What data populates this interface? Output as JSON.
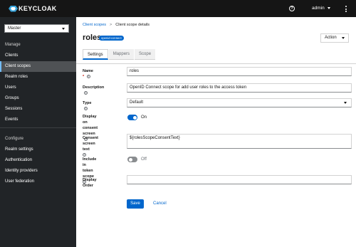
{
  "header": {
    "logo_text": "KEYCLOAK",
    "help_glyph": "?",
    "user": "admin"
  },
  "sidebar": {
    "realm": "Master",
    "manage_heading": "Manage",
    "manage_items": [
      "Clients",
      "Client scopes",
      "Realm roles",
      "Users",
      "Groups",
      "Sessions",
      "Events"
    ],
    "configure_heading": "Configure",
    "configure_items": [
      "Realm settings",
      "Authentication",
      "Identity providers",
      "User federation"
    ],
    "active_item": "Client scopes"
  },
  "breadcrumb": {
    "parent": "Client scopes",
    "separator": ">",
    "current": "Client scope details"
  },
  "page": {
    "title": "roles",
    "badge": "openid-connect",
    "action_label": "Action"
  },
  "tabs": [
    "Settings",
    "Mappers",
    "Scope"
  ],
  "form": {
    "name_label": "Name",
    "required_mark": "*",
    "name_value": "roles",
    "description_label": "Description",
    "description_value": "OpenID Connect scope for add user roles to the access token",
    "type_label": "Type",
    "type_value": "Default",
    "display_consent_label_1": "Display on consent",
    "display_consent_label_2": "screen",
    "display_consent_state": "On",
    "consent_text_label": "Consent screen text",
    "consent_text_value": "${rolesScopeConsentText}",
    "include_token_label": "Include in token scope",
    "include_token_state": "Off",
    "display_order_label": "Display Order",
    "display_order_value": "",
    "help_glyph": "?"
  },
  "buttons": {
    "save": "Save",
    "cancel": "Cancel"
  },
  "colors": {
    "primary": "#0066cc",
    "masthead": "#151515",
    "sidebar": "#212427"
  }
}
